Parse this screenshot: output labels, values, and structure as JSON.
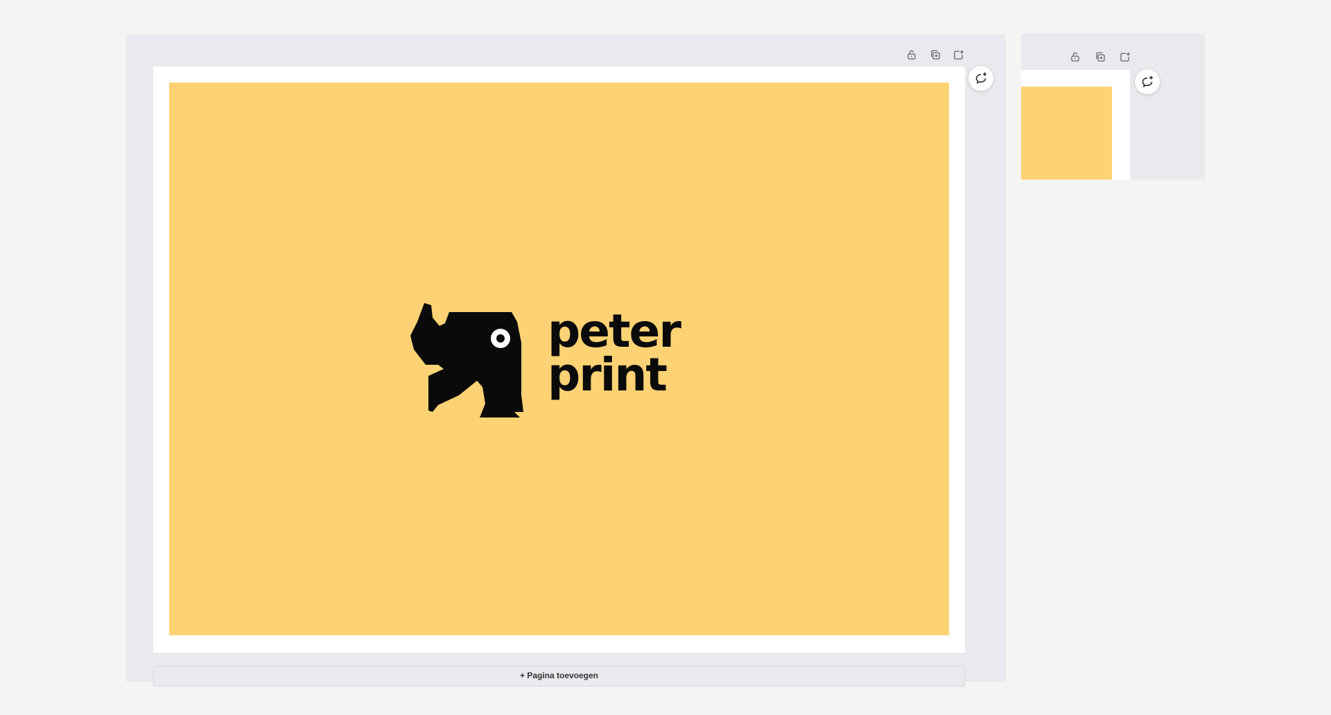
{
  "colors": {
    "canvas": "#f5f4f2",
    "panel": "#e9eaed",
    "page_border": "#ffffff",
    "page_background": "#fcd274",
    "logo": "#0a0a0a"
  },
  "toolbar": {
    "icons": [
      "lock-icon",
      "duplicate-icon",
      "add-page-icon"
    ]
  },
  "comment_icon": "comment-add-icon",
  "main_page": {
    "logo": {
      "line1": "peter",
      "line2": "print"
    }
  },
  "add_page_button": {
    "label": "+ Pagina toevoegen"
  }
}
